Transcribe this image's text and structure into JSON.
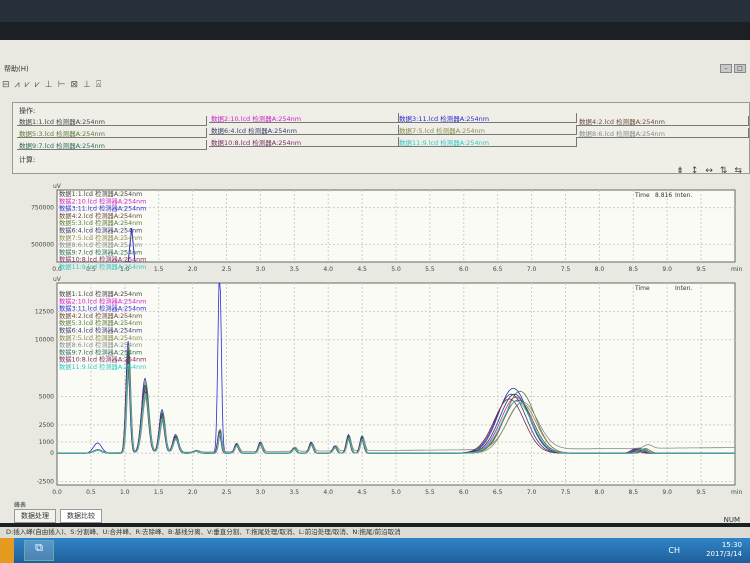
{
  "window": {
    "menu_help": "帮助(H)",
    "controls": [
      "–",
      "□"
    ]
  },
  "toolbar": {
    "icons": [
      "⊟",
      "⩘",
      "⩗",
      "⩗",
      "⊥",
      "⊢",
      "⊠",
      "⊥",
      "⍓"
    ]
  },
  "operations": {
    "label": "操作:",
    "calc_label": "计算:",
    "datasets": [
      {
        "text": "数据1:1.lcd 检测器A:254nm",
        "color": "#444444"
      },
      {
        "text": "数据2:10.lcd 检测器A:254nm",
        "color": "#d020c8"
      },
      {
        "text": "数据3:11.lcd 检测器A:254nm",
        "color": "#2a2ad0"
      },
      {
        "text": "数据4:2.lcd 检测器A:254nm",
        "color": "#6a4a3a"
      },
      {
        "text": "数据5:3.lcd 检测器A:254nm",
        "color": "#5a7a3a"
      },
      {
        "text": "数据6:4.lcd 检测器A:254nm",
        "color": "#3a3a6a"
      },
      {
        "text": "数据7:5.lcd 检测器A:254nm",
        "color": "#8a8a50"
      },
      {
        "text": "数据8:6.lcd 检测器A:254nm",
        "color": "#8a8a8a"
      },
      {
        "text": "数据9:7.lcd 检测器A:254nm",
        "color": "#2f6a5a"
      },
      {
        "text": "数据10:8.lcd 检测器A:254nm",
        "color": "#7a2a5a"
      },
      {
        "text": "数据11:9.lcd 检测器A:254nm",
        "color": "#30c8c8"
      }
    ]
  },
  "view_icons": [
    "⇟",
    "↕",
    "↔",
    "⇅",
    "⇆"
  ],
  "chart_data": [
    {
      "type": "line",
      "name": "overview",
      "ylabel": "uV",
      "xlabel": "min",
      "xlim": [
        0,
        10
      ],
      "ylim": [
        380000,
        870000
      ],
      "yticks": [
        {
          "v": 750000,
          "t": "750000"
        },
        {
          "v": 500000,
          "t": "500000"
        }
      ],
      "xticks": [
        "0.0",
        "0.5",
        "1.0",
        "1.5",
        "2.0",
        "2.5",
        "3.0",
        "3.5",
        "4.0",
        "4.5",
        "5.0",
        "5.5",
        "6.0",
        "6.5",
        "7.0",
        "7.5",
        "8.0",
        "8.5",
        "9.0",
        "9.5"
      ],
      "readout": {
        "time_label": "Time",
        "time_value": "8.816",
        "inten_label": "Inten."
      }
    },
    {
      "type": "line",
      "name": "detail",
      "ylabel": "uV",
      "xlabel": "min",
      "xlim": [
        0,
        10
      ],
      "ylim": [
        -2800,
        15000
      ],
      "yticks": [
        {
          "v": 12500,
          "t": "12500"
        },
        {
          "v": 10000,
          "t": "10000"
        },
        {
          "v": 5000,
          "t": "5000"
        },
        {
          "v": 2500,
          "t": "2500"
        },
        {
          "v": 1000,
          "t": "1000"
        },
        {
          "v": 0,
          "t": "0"
        },
        {
          "v": -2500,
          "t": "-2500"
        }
      ],
      "xticks": [
        "0.0",
        "0.5",
        "1.0",
        "1.5",
        "2.0",
        "2.5",
        "3.0",
        "3.5",
        "4.0",
        "4.5",
        "5.0",
        "5.5",
        "6.0",
        "6.5",
        "7.0",
        "7.5",
        "8.0",
        "8.5",
        "9.0",
        "9.5"
      ],
      "readout": {
        "time_label": "Time",
        "inten_label": "Inten."
      },
      "peaks": [
        [
          0.6,
          300,
          0.06
        ],
        [
          1.05,
          9000,
          0.03
        ],
        [
          1.3,
          6000,
          0.05
        ],
        [
          1.55,
          3500,
          0.04
        ],
        [
          1.75,
          1500,
          0.04
        ],
        [
          2.05,
          200,
          0.04
        ],
        [
          2.4,
          2000,
          0.025
        ],
        [
          2.65,
          800,
          0.03
        ],
        [
          3.0,
          900,
          0.03
        ],
        [
          3.5,
          450,
          0.03
        ],
        [
          3.75,
          900,
          0.03
        ],
        [
          4.1,
          600,
          0.03
        ],
        [
          4.3,
          1500,
          0.03
        ],
        [
          4.5,
          1400,
          0.03
        ],
        [
          6.75,
          5200,
          0.22
        ],
        [
          8.6,
          400,
          0.06
        ]
      ],
      "series_scale": [
        1.0,
        0.95,
        1.1,
        0.9,
        1.05,
        1.0,
        0.85,
        0.8,
        1.0,
        0.92,
        0.88
      ],
      "series_shift": [
        0.0,
        0.02,
        -0.02,
        0.05,
        0.08,
        -0.05,
        0.1,
        0.12,
        0.0,
        -0.08,
        0.03
      ]
    }
  ],
  "bottom": {
    "label": "峰表",
    "tabs": [
      "数据处理",
      "数据比较"
    ],
    "num": "NUM"
  },
  "status": "D:插入峰(自由插入)、S:分割峰、U:合并峰、R:去除峰、B:基线分离、V:垂直分割、T:拖尾处理/取消、L:前沿处理/取消、N:拖尾/前沿取消",
  "taskbar": {
    "lang": "CH",
    "time": "15:30",
    "date": "2017/3/14"
  }
}
